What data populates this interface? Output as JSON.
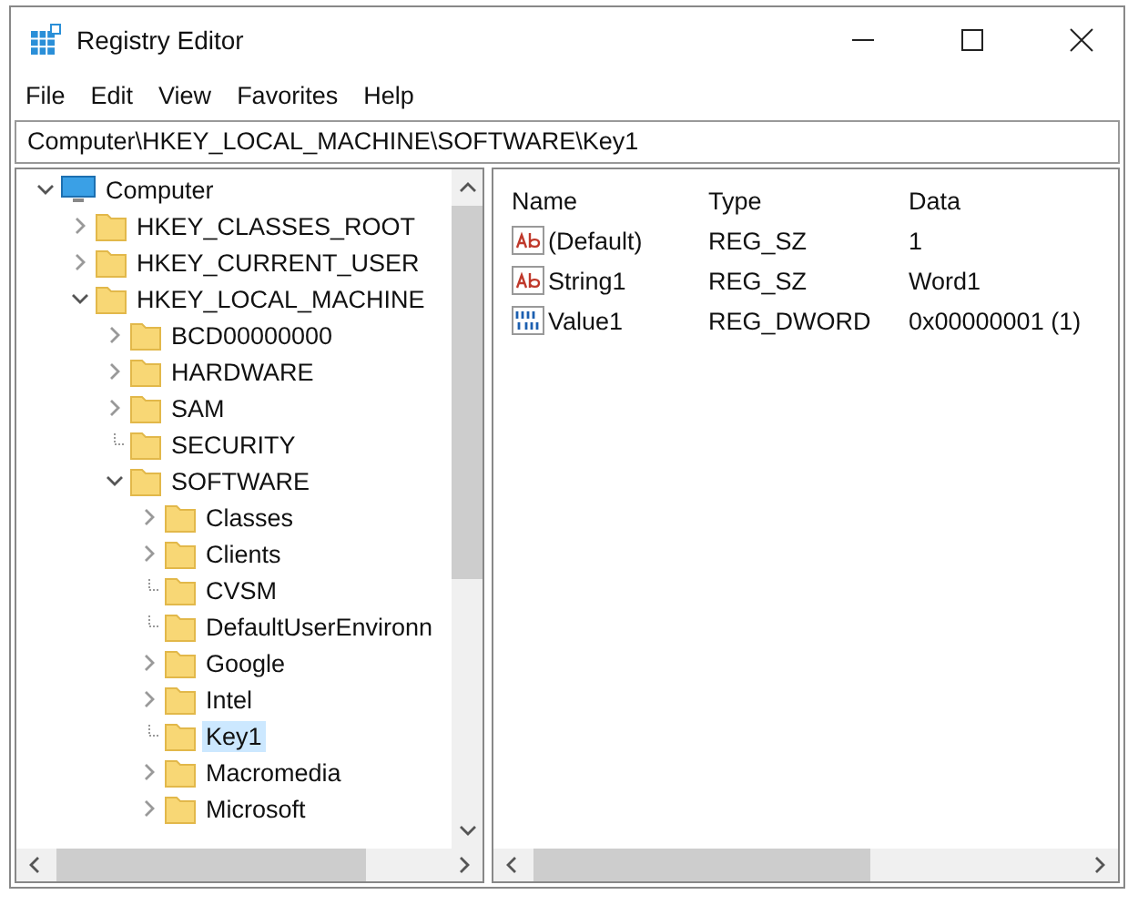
{
  "window": {
    "title": "Registry Editor"
  },
  "menu": [
    "File",
    "Edit",
    "View",
    "Favorites",
    "Help"
  ],
  "address": "Computer\\HKEY_LOCAL_MACHINE\\SOFTWARE\\Key1",
  "tree": [
    {
      "label": "Computer",
      "kind": "computer",
      "expanded": true,
      "selected": false,
      "children": [
        {
          "label": "HKEY_CLASSES_ROOT",
          "kind": "branch",
          "expanded": false,
          "selected": false
        },
        {
          "label": "HKEY_CURRENT_USER",
          "kind": "branch",
          "expanded": false,
          "selected": false
        },
        {
          "label": "HKEY_LOCAL_MACHINE",
          "kind": "branch",
          "expanded": true,
          "selected": false,
          "children": [
            {
              "label": "BCD00000000",
              "kind": "branch",
              "expanded": false,
              "selected": false
            },
            {
              "label": "HARDWARE",
              "kind": "branch",
              "expanded": false,
              "selected": false
            },
            {
              "label": "SAM",
              "kind": "branch",
              "expanded": false,
              "selected": false
            },
            {
              "label": "SECURITY",
              "kind": "leaf",
              "selected": false
            },
            {
              "label": "SOFTWARE",
              "kind": "branch",
              "expanded": true,
              "selected": false,
              "children": [
                {
                  "label": "Classes",
                  "kind": "branch",
                  "expanded": false,
                  "selected": false
                },
                {
                  "label": "Clients",
                  "kind": "branch",
                  "expanded": false,
                  "selected": false
                },
                {
                  "label": "CVSM",
                  "kind": "leaf",
                  "selected": false
                },
                {
                  "label": "DefaultUserEnvironn",
                  "kind": "leaf",
                  "selected": false
                },
                {
                  "label": "Google",
                  "kind": "branch",
                  "expanded": false,
                  "selected": false
                },
                {
                  "label": "Intel",
                  "kind": "branch",
                  "expanded": false,
                  "selected": false
                },
                {
                  "label": "Key1",
                  "kind": "leaf",
                  "selected": true
                },
                {
                  "label": "Macromedia",
                  "kind": "branch",
                  "expanded": false,
                  "selected": false
                },
                {
                  "label": "Microsoft",
                  "kind": "branch",
                  "expanded": false,
                  "selected": false
                }
              ]
            }
          ]
        }
      ]
    }
  ],
  "columns": [
    "Name",
    "Type",
    "Data"
  ],
  "values": [
    {
      "name": "(Default)",
      "type": "REG_SZ",
      "data": "1",
      "kind": "string"
    },
    {
      "name": "String1",
      "type": "REG_SZ",
      "data": "Word1",
      "kind": "string"
    },
    {
      "name": "Value1",
      "type": "REG_DWORD",
      "data": "0x00000001 (1)",
      "kind": "number"
    }
  ]
}
